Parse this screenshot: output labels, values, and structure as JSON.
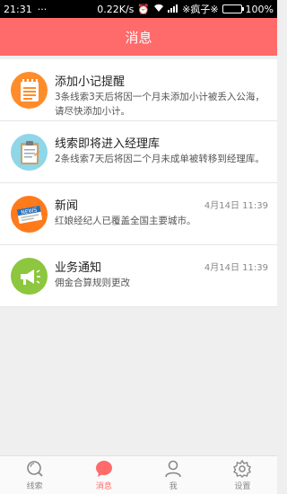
{
  "status": {
    "time": "21:31",
    "speed": "0.22K/s",
    "carrier": "※疯子※",
    "battery": "100%"
  },
  "header": {
    "title": "消息"
  },
  "messages": [
    {
      "title": "添加小记提醒",
      "desc": "3条线索3天后将因一个月未添加小计被丢入公海，请尽快添加小计。",
      "time": "",
      "icon": "notepad-icon",
      "color": "#ff8c2a"
    },
    {
      "title": "线索即将进入经理库",
      "desc": "2条线索7天后将因二个月未成单被转移到经理库。",
      "time": "",
      "icon": "clipboard-icon",
      "color": "#8fd6e8"
    },
    {
      "title": "新闻",
      "desc": "红娘经纪人已覆盖全国主要城市。",
      "time": "4月14日 11:39",
      "icon": "news-icon",
      "color": "#ff7a1a"
    },
    {
      "title": "业务通知",
      "desc": "佣金合算规则更改",
      "time": "4月14日 11:39",
      "icon": "megaphone-icon",
      "color": "#8dc63f"
    }
  ],
  "tabs": [
    {
      "label": "线索",
      "icon": "search-icon"
    },
    {
      "label": "消息",
      "icon": "chat-bubble-icon",
      "active": true
    },
    {
      "label": "我",
      "icon": "person-icon"
    },
    {
      "label": "设置",
      "icon": "gear-icon"
    }
  ],
  "colors": {
    "accent": "#ff6a6a"
  }
}
